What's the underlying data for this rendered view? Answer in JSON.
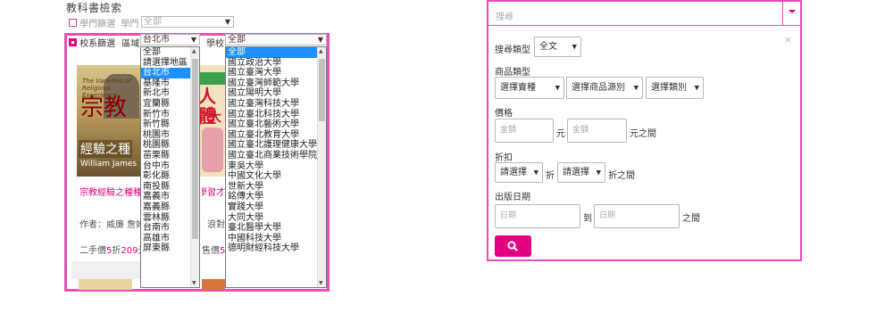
{
  "left": {
    "title": "教科書檢索",
    "subject_filter_label": "學門篩選",
    "subject_label": "學門",
    "subject_value": "全部",
    "school_filter_label": "校系篩選",
    "region_label": "區域",
    "region_value": "台北市",
    "school_label": "學校",
    "school_value": "全部",
    "region_options": [
      "全部",
      "請選擇地區",
      "台北市",
      "基隆市",
      "新北市",
      "宜蘭縣",
      "新竹市",
      "新竹縣",
      "桃園市",
      "桃園縣",
      "苗栗縣",
      "台中市",
      "彰化縣",
      "南投縣",
      "嘉義市",
      "嘉義縣",
      "雲林縣",
      "台南市",
      "高雄市",
      "屏東縣"
    ],
    "region_selected_index": 2,
    "school_options": [
      "全部",
      "國立政治大學",
      "國立臺灣大學",
      "國立臺灣師範大學",
      "國立陽明大學",
      "國立臺灣科技大學",
      "國立臺北科技大學",
      "國立臺北藝術大學",
      "國立臺北教育大學",
      "國立臺北護理健康大學",
      "國立臺北商業技術學院",
      "東吳大學",
      "中國文化大學",
      "世新大學",
      "銘傳大學",
      "實踐大學",
      "大同大學",
      "臺北醫學大學",
      "中國科技大學",
      "德明財經科技大學"
    ],
    "school_selected_index": 0,
    "book1": {
      "cover_script": "宗教",
      "cover_subtitle": "經驗之種",
      "cover_author": "William James",
      "cover_top": "The Varieties of Religious Experience",
      "title_text": "宗教經驗之種種",
      "author_text": "作者：威廉 詹姆",
      "price_prefix": "二手價",
      "discount": "5",
      "discount_unit": "折",
      "price": "209",
      "price_unit": "元"
    },
    "book2": {
      "cover_script": "人體",
      "cover_mid": "大",
      "title_text": "學習才",
      "author_text": "作者：浪對",
      "price_prefix": "售價",
      "discount": "5",
      "discount_unit": "折"
    }
  },
  "right": {
    "search_placeholder": "搜尋",
    "search_type_label": "搜尋類型",
    "search_type_value": "全文",
    "category_label": "商品類型",
    "product_type_value": "選擇賣種",
    "product_source_value": "選擇商品源別",
    "category_value": "選擇類別",
    "price_label": "價格",
    "amount_placeholder": "金額",
    "yuan": "元",
    "yuan_between": "元之間",
    "discount_label": "折扣",
    "discount_select_value": "請選擇",
    "discount_unit": "折",
    "discount_between": "折之間",
    "date_label": "出版日期",
    "date_placeholder": "日期",
    "to_label": "到",
    "date_between": "之間",
    "accent": "#e4007f"
  }
}
